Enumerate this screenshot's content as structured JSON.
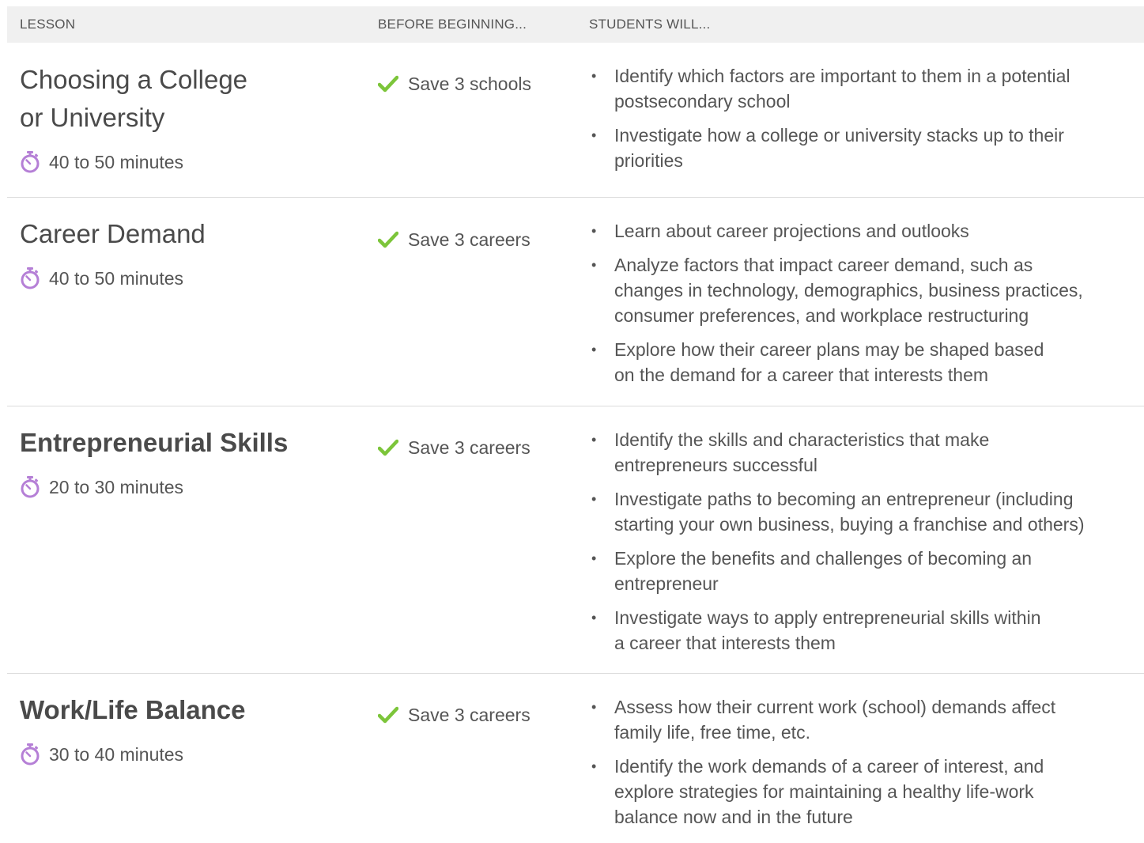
{
  "header": {
    "lesson": "LESSON",
    "before": "BEFORE BEGINNING...",
    "students": "STUDENTS WILL..."
  },
  "icons": {
    "timer": "stopwatch-icon",
    "check": "checkmark-icon"
  },
  "colors": {
    "timer": "#b57fd6",
    "check": "#7cc53a",
    "header_bg": "#f0f0f0",
    "divider": "#dcdcdc"
  },
  "lessons": [
    {
      "title_line1": "Choosing a College",
      "title_line2": "or University",
      "duration": "40 to 50 minutes",
      "before": "Save 3 schools",
      "objectives": [
        [
          "Identify which factors are important to them in a potential",
          "postsecondary school"
        ],
        [
          "Investigate how a college or university stacks up to their",
          "priorities"
        ]
      ]
    },
    {
      "title_line1": "Career Demand",
      "duration": "40 to 50 minutes",
      "before": "Save 3 careers",
      "objectives": [
        [
          "Learn about career projections and outlooks"
        ],
        [
          "Analyze factors that impact career demand, such as",
          "changes in technology, demographics, business practices,",
          "consumer preferences, and workplace restructuring"
        ],
        [
          "Explore how their career plans may be shaped based",
          "on the demand for a career that interests them"
        ]
      ]
    },
    {
      "title_line1": "Entrepreneurial Skills",
      "duration": "20 to 30 minutes",
      "before": "Save 3 careers",
      "objectives": [
        [
          "Identify the skills and characteristics that make",
          "entrepreneurs successful"
        ],
        [
          "Investigate paths to becoming an entrepreneur (including",
          "starting your own business, buying a franchise and others)"
        ],
        [
          "Explore the benefits and challenges of becoming an",
          "entrepreneur"
        ],
        [
          "Investigate ways to apply entrepreneurial skills within",
          "a career that interests them"
        ]
      ]
    },
    {
      "title_line1": "Work/Life Balance",
      "duration": "30 to 40 minutes",
      "before": "Save 3 careers",
      "objectives": [
        [
          "Assess how their current work (school) demands affect",
          "family life, free time, etc."
        ],
        [
          "Identify the work demands of a career of interest, and",
          "explore strategies for maintaining a healthy life-work",
          "balance now and in the future"
        ]
      ]
    }
  ]
}
